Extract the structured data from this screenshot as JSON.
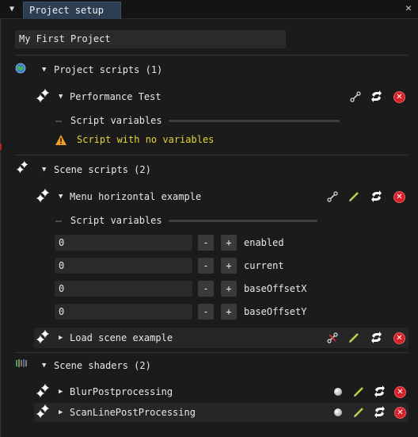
{
  "window": {
    "tab_title": "Project setup",
    "menu_icon": "triangle-menu-icon",
    "close_icon": "close-icon"
  },
  "project": {
    "name": "My First Project"
  },
  "project_scripts": {
    "header": "Project scripts (1)",
    "items": [
      {
        "name": "Performance Test",
        "variables_label": "Script variables",
        "warning": "Script with no variables"
      }
    ]
  },
  "scene_scripts": {
    "header": "Scene scripts (2)",
    "items": [
      {
        "name": "Menu horizontal example",
        "variables_label": "Script variables",
        "variables": [
          {
            "value": "0",
            "name": "enabled"
          },
          {
            "value": "0",
            "name": "current"
          },
          {
            "value": "0",
            "name": "baseOffsetX"
          },
          {
            "value": "0",
            "name": "baseOffsetY"
          }
        ],
        "minus": "-",
        "plus": "+"
      },
      {
        "name": "Load scene example"
      }
    ]
  },
  "scene_shaders": {
    "header": "Scene shaders (2)",
    "items": [
      {
        "name": "BlurPostprocessing"
      },
      {
        "name": "ScanLinePostProcessing"
      }
    ]
  },
  "colors": {
    "accent_tab": "#2d3e52",
    "warning": "#e6d23a",
    "remove": "#d8202a",
    "edit": "#b8d24a"
  }
}
